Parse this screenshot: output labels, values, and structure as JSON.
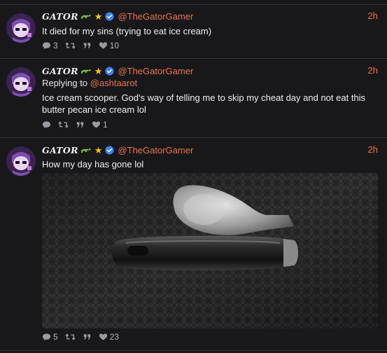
{
  "feed": {
    "tweets": [
      {
        "display_name": "GATOR",
        "handle": "@TheGatorGamer",
        "time": "2h",
        "text": "It died for my sins (trying to eat ice cream)",
        "actions": {
          "replies": "3",
          "likes": "10"
        }
      },
      {
        "display_name": "GATOR",
        "handle": "@TheGatorGamer",
        "time": "2h",
        "replying_prefix": "Replying to",
        "replying_to": "@ashtaarot",
        "text": "Ice cream scooper. God's way of telling me to skip my cheat day and not eat this butter pecan ice cream lol",
        "actions": {
          "likes": "1"
        }
      },
      {
        "display_name": "GATOR",
        "handle": "@TheGatorGamer",
        "time": "2h",
        "text": "How my day has gone lol",
        "actions": {
          "replies": "5",
          "likes": "23"
        }
      }
    ]
  },
  "icons": {
    "gator": "gator-icon",
    "star": "star-icon",
    "verified": "verified-badge-icon",
    "reply": "reply-icon",
    "retweet": "retweet-icon",
    "quote": "quote-icon",
    "like": "heart-icon"
  },
  "colors": {
    "background": "#18181b",
    "accent": "#e8734e",
    "verified": "#3b82f6",
    "star": "#f5c518",
    "muted": "#9a9aa0"
  },
  "glyphs": {
    "star": "★",
    "quote": "❞"
  }
}
